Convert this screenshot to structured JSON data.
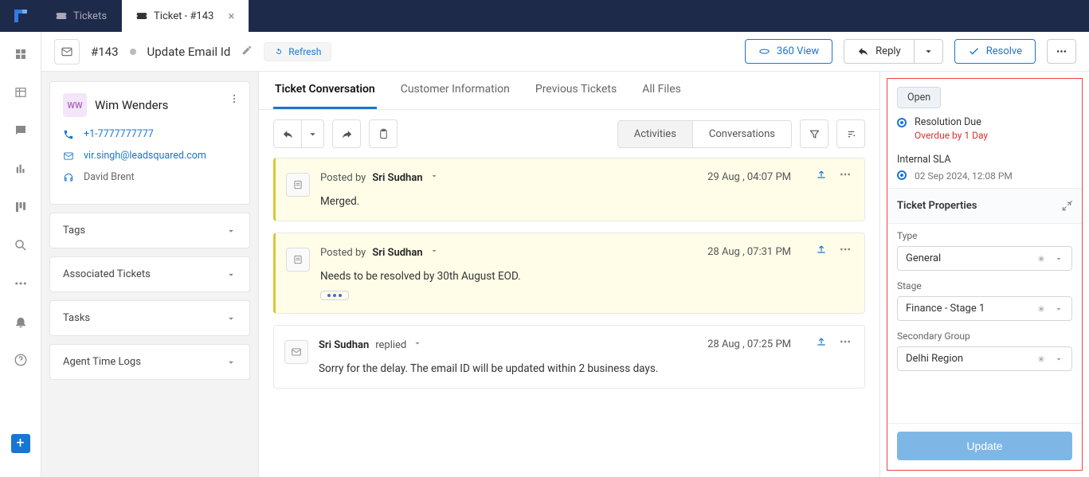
{
  "tabs": {
    "list": {
      "label": "Tickets"
    },
    "detail": {
      "label": "Ticket - #143"
    }
  },
  "header": {
    "id": "#143",
    "title": "Update Email Id",
    "refresh": "Refresh",
    "view360": "360 View",
    "reply": "Reply",
    "resolve": "Resolve"
  },
  "customer": {
    "initials": "WW",
    "name": "Wim Wenders",
    "phone": "+1-7777777777",
    "email": "vir.singh@leadsquared.com",
    "owner": "David Brent"
  },
  "sidebar_sections": {
    "tags": "Tags",
    "assoc": "Associated Tickets",
    "tasks": "Tasks",
    "timelogs": "Agent Time Logs"
  },
  "detail_tabs": {
    "conv": "Ticket Conversation",
    "cust": "Customer Information",
    "prev": "Previous Tickets",
    "files": "All Files"
  },
  "toolbar_seg": {
    "activities": "Activities",
    "conversations": "Conversations"
  },
  "messages": [
    {
      "kind": "note",
      "prefix": "Posted by",
      "author": "Sri Sudhan",
      "time": "29 Aug , 04:07 PM",
      "body": "Merged.",
      "ellipsis": false
    },
    {
      "kind": "note",
      "prefix": "Posted by",
      "author": "Sri Sudhan",
      "time": "28 Aug , 07:31 PM",
      "body": "Needs to be resolved by 30th August EOD.",
      "ellipsis": true
    },
    {
      "kind": "reply",
      "prefix_after": "replied",
      "author": "Sri Sudhan",
      "time": "28 Aug , 07:25 PM",
      "body": "Sorry for the delay. The email ID will be updated within 2 business days.",
      "ellipsis": false
    }
  ],
  "props": {
    "status": "Open",
    "resolution_due_label": "Resolution Due",
    "resolution_due_sub": "Overdue by 1 Day",
    "internal_sla_label": "Internal SLA",
    "internal_sla_value": "02 Sep 2024, 12:08 PM",
    "section_title": "Ticket Properties",
    "fields": {
      "type": {
        "label": "Type",
        "value": "General"
      },
      "stage": {
        "label": "Stage",
        "value": "Finance - Stage 1"
      },
      "secgroup": {
        "label": "Secondary Group",
        "value": "Delhi Region"
      }
    },
    "update": "Update"
  }
}
